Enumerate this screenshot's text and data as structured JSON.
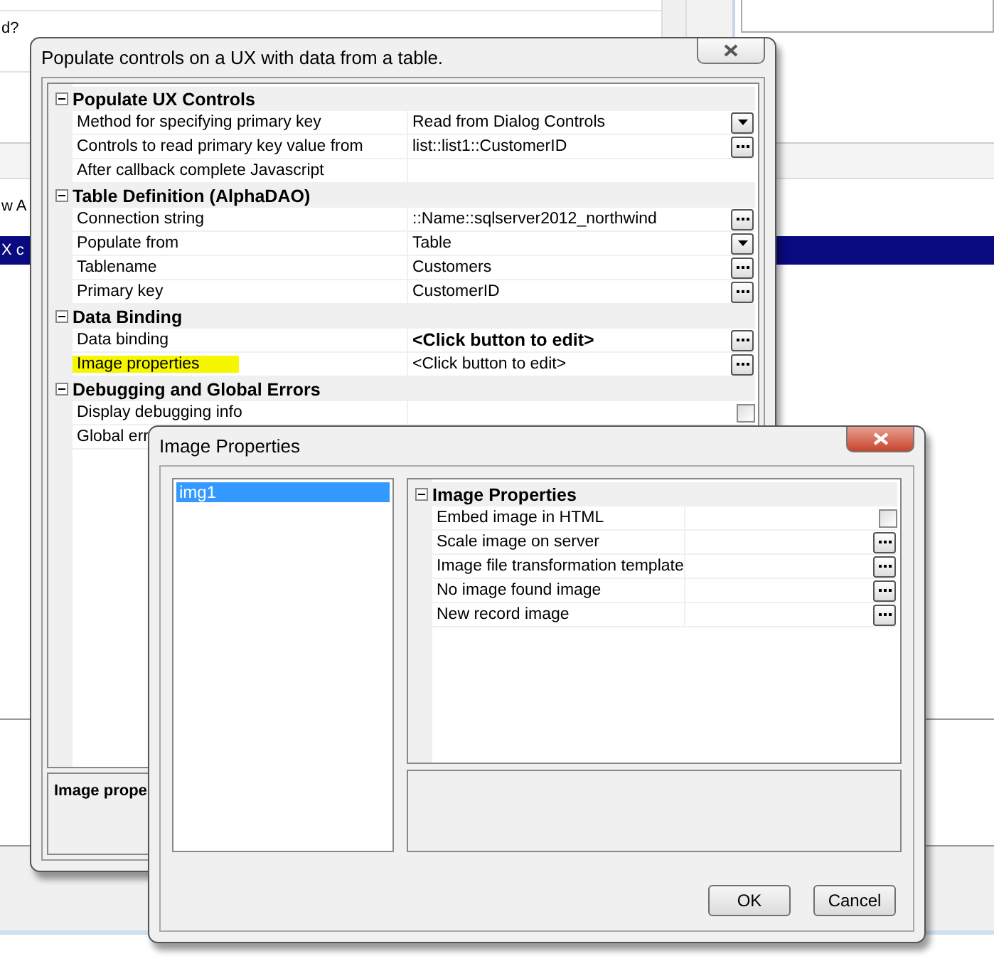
{
  "background": {
    "rows": [
      {
        "text": "d?",
        "selected": false
      },
      {
        "text": "w A",
        "selected": false
      },
      {
        "text": "X c",
        "selected": true
      }
    ]
  },
  "main_dialog": {
    "title": "Populate controls on a UX with data from a table.",
    "groups": [
      {
        "title": "Populate UX Controls",
        "expanded": true,
        "rows": [
          {
            "label": "Method for specifying primary key",
            "value": "Read from Dialog Controls",
            "kind": "dropdown"
          },
          {
            "label": "Controls to read primary key value from",
            "value": "list::list1::CustomerID",
            "kind": "browse"
          },
          {
            "label": "After callback complete Javascript",
            "kind": "plain"
          }
        ]
      },
      {
        "title": "Table Definition (AlphaDAO)",
        "expanded": true,
        "rows": [
          {
            "label": "Connection string",
            "value": "::Name::sqlserver2012_northwind",
            "kind": "browse"
          },
          {
            "label": "Populate from",
            "value": "Table",
            "kind": "dropdown"
          },
          {
            "label": "Tablename",
            "value": "Customers",
            "kind": "browse"
          },
          {
            "label": "Primary key",
            "value": "CustomerID",
            "kind": "browse"
          }
        ]
      },
      {
        "title": "Data Binding",
        "expanded": true,
        "rows": [
          {
            "label": "Data binding",
            "value": "<Click button to edit>",
            "kind": "browse",
            "bold": true
          },
          {
            "label": "Image properties",
            "value": "<Click button to edit>",
            "kind": "browse",
            "highlighted": true
          }
        ]
      },
      {
        "title": "Debugging and Global Errors",
        "expanded": true,
        "rows": [
          {
            "label": "Display debugging info",
            "kind": "checkbox",
            "checked": false
          },
          {
            "label": "Global err",
            "kind": "plain"
          }
        ]
      }
    ],
    "description_title": "Image prope"
  },
  "image_dialog": {
    "title": "Image Properties",
    "list": [
      {
        "label": "img1",
        "selected": true
      }
    ],
    "groups": [
      {
        "title": "Image Properties",
        "expanded": true,
        "rows": [
          {
            "label": "Embed image in HTML",
            "kind": "checkbox",
            "checked": false
          },
          {
            "label": "Scale image on server",
            "kind": "browse"
          },
          {
            "label": "Image file transformation template",
            "kind": "browse"
          },
          {
            "label": "No image found image",
            "kind": "browse"
          },
          {
            "label": "New record image",
            "kind": "browse"
          }
        ]
      }
    ],
    "buttons": [
      "OK",
      "Cancel"
    ]
  }
}
